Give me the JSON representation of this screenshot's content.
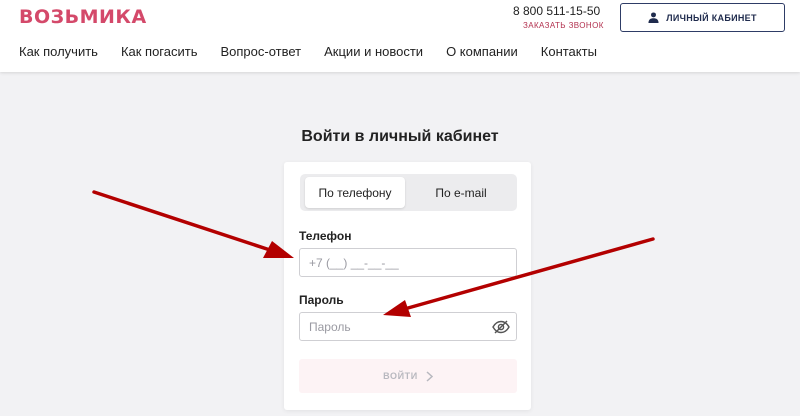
{
  "header": {
    "logo": "ВОЗЬМИКА",
    "phone": "8 800 511-15-50",
    "callback": "ЗАКАЗАТЬ ЗВОНОК",
    "cabinet_button": "ЛИЧНЫЙ КАБИНЕТ",
    "nav": [
      "Как получить",
      "Как погасить",
      "Вопрос-ответ",
      "Акции и новости",
      "О компании",
      "Контакты"
    ]
  },
  "login": {
    "title": "Войти в личный кабинет",
    "tabs": [
      {
        "label": "По телефону",
        "active": true
      },
      {
        "label": "По e-mail",
        "active": false
      }
    ],
    "phone_label": "Телефон",
    "phone_placeholder": "+7 (__) __-__-__",
    "phone_value": "",
    "password_label": "Пароль",
    "password_placeholder": "Пароль",
    "password_value": "",
    "password_toggle_icon": "eye-off-icon",
    "submit": "ВОЙТИ"
  },
  "colors": {
    "brand": "#d4496a",
    "callback": "#b2304e",
    "cabinet_border": "#2e3c66",
    "annotation_arrow": "#b30000"
  }
}
